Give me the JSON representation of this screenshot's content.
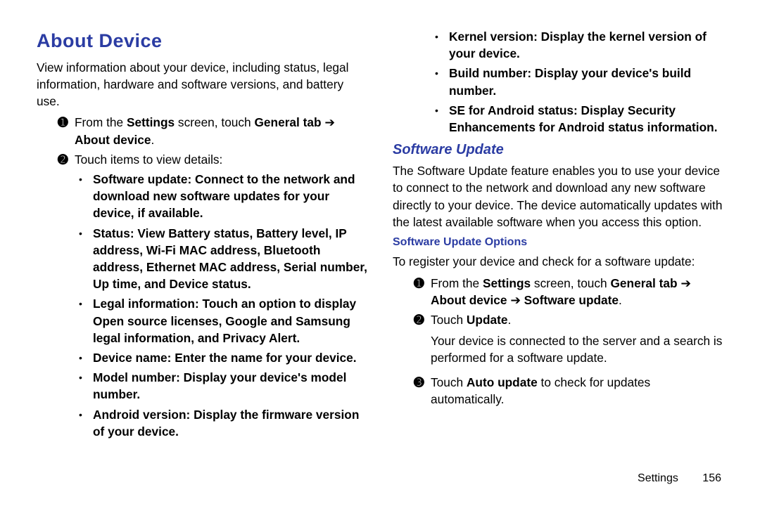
{
  "h1": "About Device",
  "intro": "View information about your device, including status, legal information, hardware and software versions, and battery use.",
  "step_from_a": "From the ",
  "settings_word": "Settings",
  "step_from_b": " screen, touch ",
  "general_tab": "General tab",
  "arrow": " ➔ ",
  "about_device": "About device",
  "period": ".",
  "touch_items": "Touch items to view details:",
  "items": [
    {
      "t": "Software update",
      "d": ": Connect to the network and download new software updates for your device, if available."
    },
    {
      "t": "Status",
      "d": ": View Battery status, Battery level, IP address, Wi-Fi MAC address, Bluetooth address, Ethernet MAC address, Serial number, Up time, and Device status."
    },
    {
      "t": "Legal information",
      "d": ": Touch an option to display Open source licenses, Google and Samsung legal information, and Privacy Alert."
    },
    {
      "t": "Device name",
      "d": ": Enter the name for your device."
    },
    {
      "t": "Model number",
      "d": ": Display your device's model number."
    },
    {
      "t": "Android version",
      "d": ": Display the firmware version of your device."
    },
    {
      "t": "Kernel version",
      "d": ": Display the kernel version of your device."
    },
    {
      "t": "Build number",
      "d": ": Display your device's build number."
    },
    {
      "t": "SE for Android status",
      "d": ": Display Security Enhancements for Android status information."
    }
  ],
  "su_h2": "Software Update",
  "su_intro": "The Software Update feature enables you to use your device to connect to the network and download any new software directly to your device. The device automatically updates with the latest available software when you access this option.",
  "su_h3": "Software Update Options",
  "su_register": "To register your device and check for a software update:",
  "software_update": "Software update",
  "touch_word": "Touch ",
  "update_word": "Update",
  "su_step2_body": "Your device is connected to the server and a search is performed for a software update.",
  "auto_update": "Auto update",
  "su_step3_tail": " to check for updates automatically.",
  "footer_section": "Settings",
  "footer_page": "156"
}
